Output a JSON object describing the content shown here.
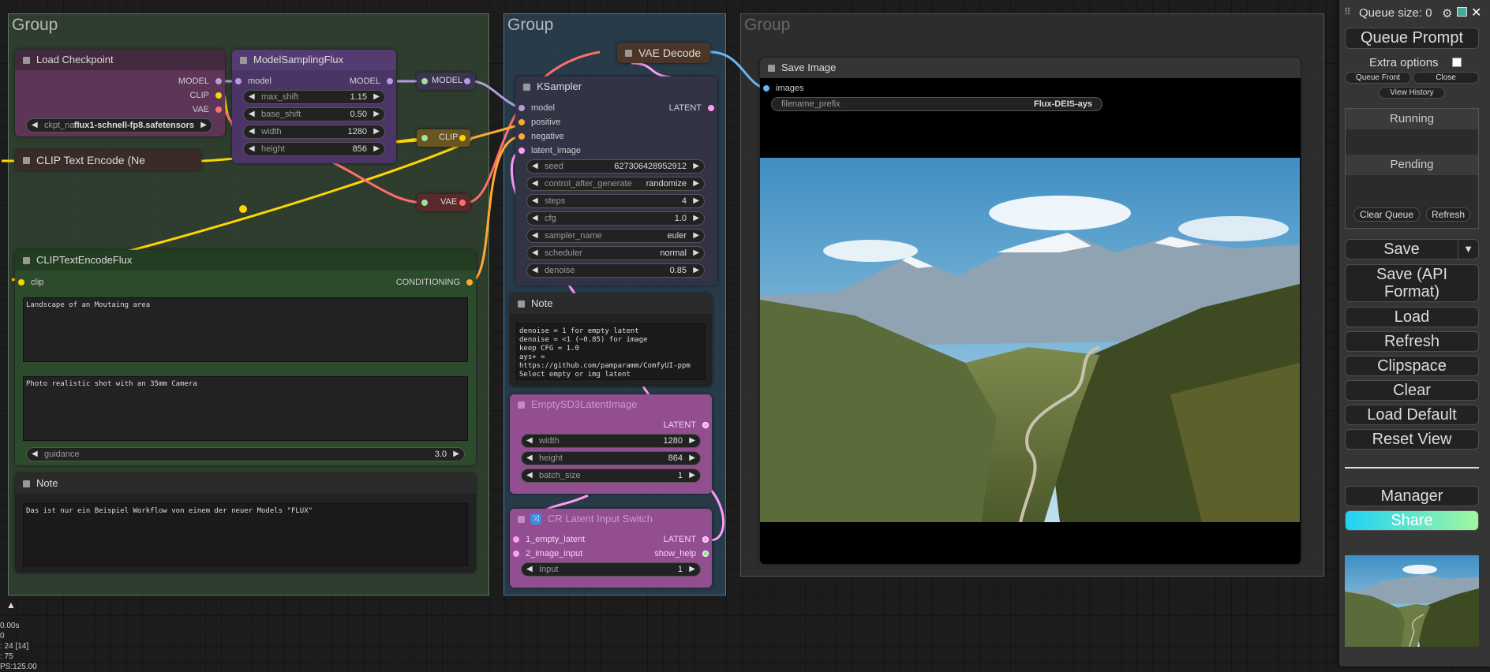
{
  "groups": [
    {
      "title": "Group",
      "color": "#3f5a3f"
    },
    {
      "title": "Group",
      "color": "#33566e"
    },
    {
      "title": "Group",
      "color": "#444444"
    }
  ],
  "load_checkpoint": {
    "title": "Load Checkpoint",
    "outputs": [
      "MODEL",
      "CLIP",
      "VAE"
    ],
    "ckpt_label": "ckpt_nam",
    "ckpt_value": "flux1-schnell-fp8.safetensors"
  },
  "clip_text_encode": {
    "title": "CLIP Text Encode (Ne"
  },
  "model_sampling": {
    "title": "ModelSamplingFlux",
    "input": "model",
    "output": "MODEL",
    "widgets": [
      {
        "label": "max_shift",
        "value": "1.15"
      },
      {
        "label": "base_shift",
        "value": "0.50"
      },
      {
        "label": "width",
        "value": "1280"
      },
      {
        "label": "height",
        "value": "856"
      }
    ]
  },
  "reroutes": {
    "model": "MODEL",
    "clip": "CLIP",
    "vae": "VAE"
  },
  "vae_decode": {
    "title": "VAE Decode"
  },
  "ksampler": {
    "title": "KSampler",
    "inputs": [
      "model",
      "positive",
      "negative",
      "latent_image"
    ],
    "output": "LATENT",
    "widgets": [
      {
        "label": "seed",
        "value": "627306428952912"
      },
      {
        "label": "control_after_generate",
        "value": "randomize"
      },
      {
        "label": "steps",
        "value": "4"
      },
      {
        "label": "cfg",
        "value": "1.0"
      },
      {
        "label": "sampler_name",
        "value": "euler"
      },
      {
        "label": "scheduler",
        "value": "normal"
      },
      {
        "label": "denoise",
        "value": "0.85"
      }
    ]
  },
  "note_center": {
    "title": "Note",
    "text": "denoise = 1 for empty latent\ndenoise = <1 (~0.85) for image\nkeep CFG = 1.0\nays+ = https://github.com/pamparamm/ComfyUI-ppm\nSelect empty or img latent"
  },
  "empty_latent": {
    "title": "EmptySD3LatentImage",
    "output": "LATENT",
    "widgets": [
      {
        "label": "width",
        "value": "1280"
      },
      {
        "label": "height",
        "value": "864"
      },
      {
        "label": "batch_size",
        "value": "1"
      }
    ]
  },
  "latent_switch": {
    "title": "CR Latent Input Switch",
    "inputs": [
      "1_empty_latent",
      "2_image_input"
    ],
    "outputs": [
      "LATENT",
      "show_help"
    ],
    "widget": {
      "label": "Input",
      "value": "1"
    }
  },
  "clip_flux": {
    "title": "CLIPTextEncodeFlux",
    "input": "clip",
    "output": "CONDITIONING",
    "text1": "Landscape of an Moutaing area",
    "text2": "Photo realistic shot with an 35mm Camera",
    "guidance_label": "guidance",
    "guidance_value": "3.0"
  },
  "note_left": {
    "title": "Note",
    "text": "Das ist nur ein Beispiel Workflow von einem der neuer Models \"FLUX\""
  },
  "save_image": {
    "title": "Save Image",
    "input": "images",
    "prefix_label": "filename_prefix",
    "prefix_value": "Flux-DEIS-ays"
  },
  "stats": [
    "0.00s",
    "0",
    ": 24 [14]",
    ": 75",
    "PS:125.00"
  ],
  "sidebar": {
    "queue_size": "Queue size: 0",
    "queue_prompt": "Queue Prompt",
    "extra_options": "Extra options",
    "queue_front": "Queue Front",
    "close": "Close",
    "view_history": "View History",
    "running": "Running",
    "pending": "Pending",
    "clear_queue": "Clear Queue",
    "refresh_small": "Refresh",
    "save": "Save",
    "save_api": "Save (API Format)",
    "load": "Load",
    "refresh": "Refresh",
    "clipspace": "Clipspace",
    "clear": "Clear",
    "load_default": "Load Default",
    "reset_view": "Reset View",
    "manager": "Manager",
    "share": "Share"
  },
  "colors": {
    "model": "#b39ddb",
    "clip": "#ffd500",
    "vae": "#ff6e6e",
    "latent": "#ff9cf9",
    "conditioning": "#ffa931",
    "image": "#64b5f6",
    "share_gradient": [
      "#1fd2f5",
      "#a0f7a0"
    ]
  }
}
